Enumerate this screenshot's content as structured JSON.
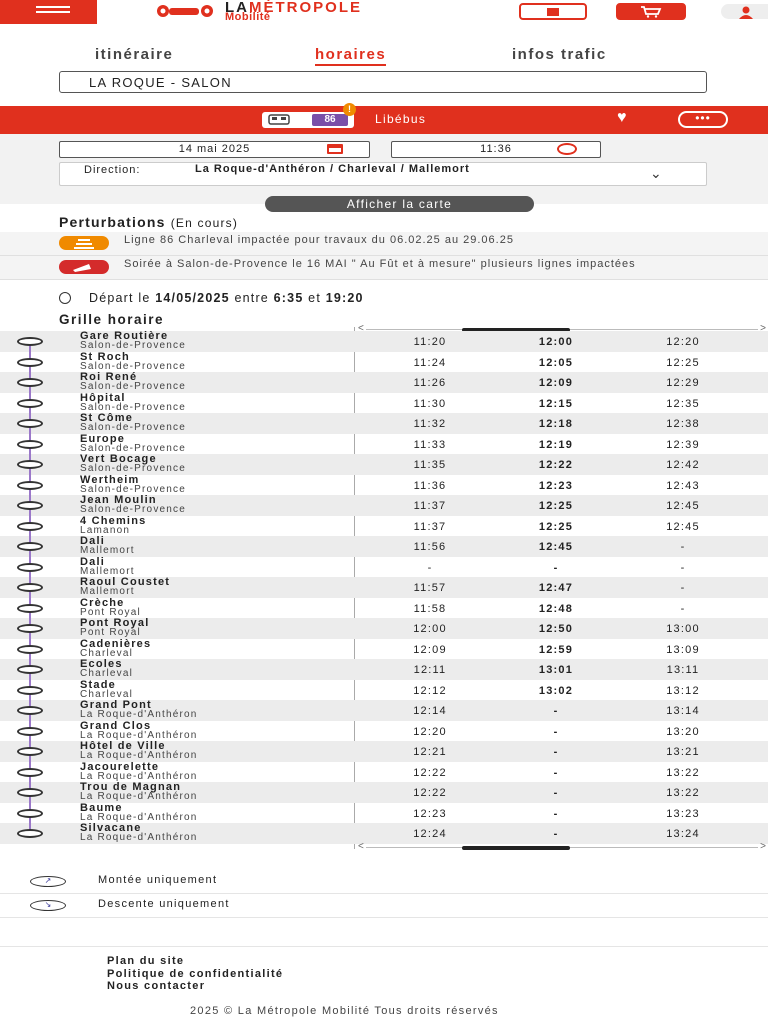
{
  "header": {
    "logo_line1_prefix": "LA",
    "logo_line1": "MÉTROPOLE",
    "logo_line2": "Mobilité",
    "icons": [
      "menu-icon",
      "calendar-icon",
      "cart-icon",
      "user-icon"
    ]
  },
  "tabs": [
    {
      "label": "itinéraire",
      "active": false
    },
    {
      "label": "horaires",
      "active": true
    },
    {
      "label": "infos trafic",
      "active": false
    }
  ],
  "line_field": {
    "value": "LA ROQUE - SALON"
  },
  "line_bar": {
    "number": "86",
    "alert_badge": "!",
    "network": "Libébus",
    "more_label": "•••",
    "accent_color": "#e0301e",
    "line_color": "#7a4fa8"
  },
  "filters": {
    "date": "14 mai 2025",
    "time": "11:36",
    "direction_label": "Direction:",
    "direction_value": "La Roque-d'Anthéron / Charleval / Mallemort",
    "map_button": "Afficher la carte"
  },
  "perturbations": {
    "title": "Perturbations",
    "subtitle": "(En cours)",
    "items": [
      {
        "text": "Ligne 86 Charleval impactée pour travaux du 06.02.25 au 29.06.25",
        "color": "#f08a00"
      },
      {
        "text": "Soirée à Salon-de-Provence le 16 MAI \" Au Fût et à mesure\" plusieurs lignes impactées",
        "color": "#d42b2b"
      }
    ]
  },
  "departure": {
    "prefix": "Départ le",
    "date": "14/05/2025",
    "between": "entre",
    "start": "6:35",
    "and": "et",
    "end": "19:20"
  },
  "grid_title": "Grille horaire",
  "stops": [
    {
      "name": "Gare Routière",
      "city": "Salon-de-Provence",
      "times": [
        "11:20",
        "12:00",
        "12:20"
      ]
    },
    {
      "name": "St Roch",
      "city": "Salon-de-Provence",
      "times": [
        "11:24",
        "12:05",
        "12:25"
      ]
    },
    {
      "name": "Roi René",
      "city": "Salon-de-Provence",
      "times": [
        "11:26",
        "12:09",
        "12:29"
      ]
    },
    {
      "name": "Hôpital",
      "city": "Salon-de-Provence",
      "times": [
        "11:30",
        "12:15",
        "12:35"
      ]
    },
    {
      "name": "St Côme",
      "city": "Salon-de-Provence",
      "times": [
        "11:32",
        "12:18",
        "12:38"
      ]
    },
    {
      "name": "Europe",
      "city": "Salon-de-Provence",
      "times": [
        "11:33",
        "12:19",
        "12:39"
      ]
    },
    {
      "name": "Vert Bocage",
      "city": "Salon-de-Provence",
      "times": [
        "11:35",
        "12:22",
        "12:42"
      ]
    },
    {
      "name": "Wertheim",
      "city": "Salon-de-Provence",
      "times": [
        "11:36",
        "12:23",
        "12:43"
      ]
    },
    {
      "name": "Jean Moulin",
      "city": "Salon-de-Provence",
      "times": [
        "11:37",
        "12:25",
        "12:45"
      ]
    },
    {
      "name": "4 Chemins",
      "city": "Lamanon",
      "times": [
        "11:37",
        "12:25",
        "12:45"
      ]
    },
    {
      "name": "Dali",
      "city": "Mallemort",
      "times": [
        "11:56",
        "12:45",
        "-"
      ]
    },
    {
      "name": "Dali",
      "city": "Mallemort",
      "times": [
        "-",
        "-",
        "-"
      ]
    },
    {
      "name": "Raoul Coustet",
      "city": "Mallemort",
      "times": [
        "11:57",
        "12:47",
        "-"
      ]
    },
    {
      "name": "Crèche",
      "city": "Pont Royal",
      "times": [
        "11:58",
        "12:48",
        "-"
      ]
    },
    {
      "name": "Pont Royal",
      "city": "Pont Royal",
      "times": [
        "12:00",
        "12:50",
        "13:00"
      ]
    },
    {
      "name": "Cadenières",
      "city": "Charleval",
      "times": [
        "12:09",
        "12:59",
        "13:09"
      ]
    },
    {
      "name": "Ecoles",
      "city": "Charleval",
      "times": [
        "12:11",
        "13:01",
        "13:11"
      ]
    },
    {
      "name": "Stade",
      "city": "Charleval",
      "times": [
        "12:12",
        "13:02",
        "13:12"
      ]
    },
    {
      "name": "Grand Pont",
      "city": "La Roque-d'Anthéron",
      "times": [
        "12:14",
        "-",
        "13:14"
      ]
    },
    {
      "name": "Grand Clos",
      "city": "La Roque-d'Anthéron",
      "times": [
        "12:20",
        "-",
        "13:20"
      ]
    },
    {
      "name": "Hôtel de Ville",
      "city": "La Roque-d'Anthéron",
      "times": [
        "12:21",
        "-",
        "13:21"
      ]
    },
    {
      "name": "Jacourelette",
      "city": "La Roque-d'Anthéron",
      "times": [
        "12:22",
        "-",
        "13:22"
      ]
    },
    {
      "name": "Trou de Magnan",
      "city": "La Roque-d'Anthéron",
      "times": [
        "12:22",
        "-",
        "13:22"
      ]
    },
    {
      "name": "Baume",
      "city": "La Roque-d'Anthéron",
      "times": [
        "12:23",
        "-",
        "13:23"
      ]
    },
    {
      "name": "Silvacane",
      "city": "La Roque-d'Anthéron",
      "times": [
        "12:24",
        "-",
        "13:24"
      ]
    }
  ],
  "legend": [
    {
      "icon": "boarding-only-icon",
      "label": "Montée uniquement"
    },
    {
      "icon": "alighting-only-icon",
      "label": "Descente uniquement"
    }
  ],
  "footer": {
    "links": [
      "Plan du site",
      "Politique de confidentialité",
      "Nous contacter"
    ],
    "copyright": "2025 © La Métropole Mobilité Tous droits réservés"
  }
}
